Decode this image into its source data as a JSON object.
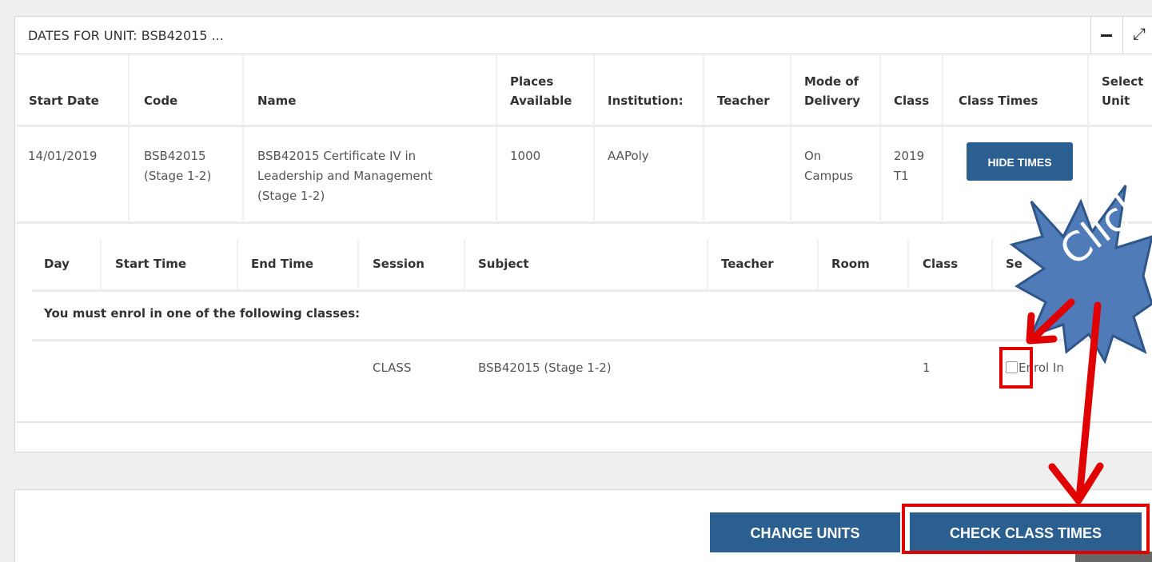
{
  "panel": {
    "title": "DATES FOR UNIT: BSB42015 ..."
  },
  "main_table": {
    "headers": {
      "start_date": "Start Date",
      "code": "Code",
      "name": "Name",
      "places_line1": "Places",
      "places_line2": "Available",
      "institution": "Institution:",
      "teacher": "Teacher",
      "mode_line1": "Mode of",
      "mode_line2": "Delivery",
      "class": "Class",
      "class_times": "Class Times",
      "select_line1": "Select",
      "select_line2": "Unit"
    },
    "row": {
      "start_date": "14/01/2019",
      "code_line1": "BSB42015",
      "code_line2": "(Stage 1-2)",
      "name_line1": "BSB42015 Certificate IV in",
      "name_line2": "Leadership and Management",
      "name_line3": "(Stage 1-2)",
      "places": "1000",
      "institution": "AAPoly",
      "teacher": "",
      "mode_line1": "On",
      "mode_line2": "Campus",
      "class_line1": "2019",
      "class_line2": "T1",
      "hide_times_label": "HIDE TIMES"
    }
  },
  "times_table": {
    "headers": {
      "day": "Day",
      "start_time": "Start Time",
      "end_time": "End Time",
      "session": "Session",
      "subject": "Subject",
      "teacher": "Teacher",
      "room": "Room",
      "class": "Class",
      "select": "Se"
    },
    "notice": "You must enrol in one of the following classes:",
    "row": {
      "session": "CLASS",
      "subject": "BSB42015 (Stage 1-2)",
      "class": "1",
      "enrol_label": "Enrol In"
    }
  },
  "footer": {
    "change_units_label": "CHANGE UNITS",
    "check_class_times_label": "CHECK CLASS TIMES"
  },
  "annotation": {
    "callout_text": "Click",
    "arrow_color": "#e00000",
    "star_color": "#4f7bb8"
  },
  "colors": {
    "button": "#2b5f8f",
    "highlight": "#e00000"
  }
}
